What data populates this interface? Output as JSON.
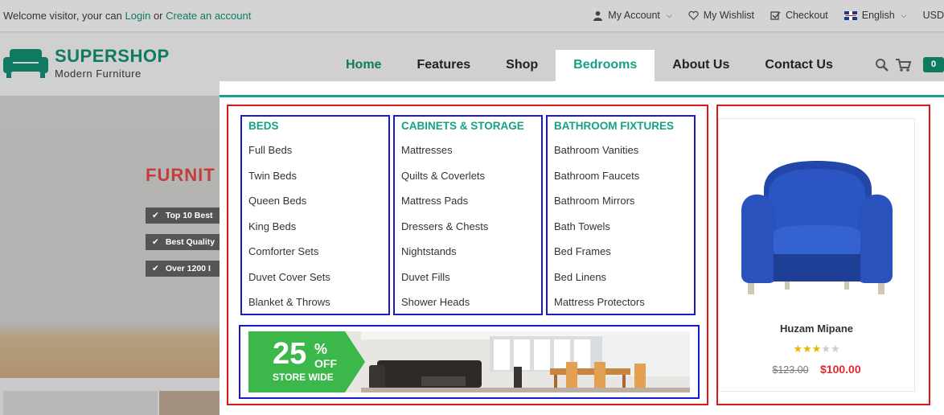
{
  "topbar": {
    "welcome_prefix": "Welcome visitor, your can",
    "login": "Login",
    "or": "or",
    "create": "Create an account",
    "my_account": "My Account",
    "wishlist": "My Wishlist",
    "checkout": "Checkout",
    "language": "English",
    "currency": "USD"
  },
  "logo": {
    "name": "SUPERSHOP",
    "tagline": "Modern Furniture"
  },
  "nav": {
    "items": [
      "Home",
      "Features",
      "Shop",
      "Bedrooms",
      "About Us",
      "Contact Us"
    ],
    "active": "Bedrooms",
    "cart_count": "0"
  },
  "hero": {
    "title": "FURNIT",
    "badges": [
      "Top 10 Best",
      "Best Quality",
      "Over 1200 I"
    ]
  },
  "mega": {
    "columns": [
      {
        "title": "BEDS",
        "items": [
          "Full Beds",
          "Twin Beds",
          "Queen Beds",
          "King Beds",
          "Comforter Sets",
          "Duvet Cover Sets",
          "Blanket & Throws"
        ]
      },
      {
        "title": "CABINETS & STORAGE",
        "items": [
          "Mattresses",
          "Quilts & Coverlets",
          "Mattress Pads",
          "Dressers & Chests",
          "Nightstands",
          "Duvet Fills",
          "Shower Heads"
        ]
      },
      {
        "title": "BATHROOM FIXTURES",
        "items": [
          "Bathroom Vanities",
          "Bathroom Faucets",
          "Bathroom Mirrors",
          "Bath Towels",
          "Bed Frames",
          "Bed Linens",
          "Mattress Protectors"
        ]
      }
    ],
    "banner": {
      "percent": "25",
      "percent_sign": "%",
      "off": "OFF",
      "store_wide": "STORE WIDE"
    },
    "product": {
      "name": "Huzam Mipane",
      "rating": 3,
      "max_rating": 5,
      "old_price": "$123.00",
      "new_price": "$100.00"
    }
  },
  "colors": {
    "brand": "#0f7a62",
    "accent": "#17a085",
    "price": "#e0262e",
    "annotation_red": "#e01515",
    "annotation_blue": "#1a1acc"
  }
}
